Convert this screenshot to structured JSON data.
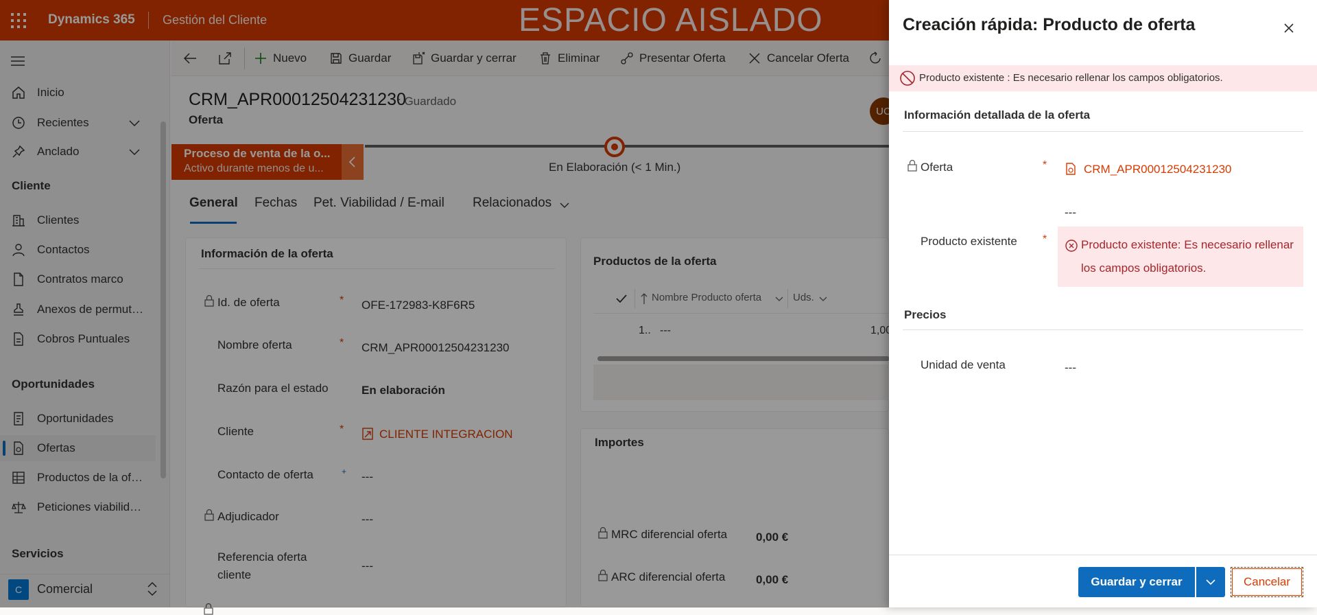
{
  "topbar": {
    "app_name": "Dynamics 365",
    "area_name": "Gestión del Cliente",
    "sandbox_label": "ESPACIO AISLADO"
  },
  "sidebar": {
    "items_top": [
      {
        "label": "Inicio",
        "icon": "home-icon"
      },
      {
        "label": "Recientes",
        "icon": "clock-icon"
      },
      {
        "label": "Anclado",
        "icon": "pin-icon"
      }
    ],
    "sections": [
      {
        "title": "Cliente",
        "items": [
          {
            "label": "Clientes",
            "icon": "building-icon"
          },
          {
            "label": "Contactos",
            "icon": "person-icon"
          },
          {
            "label": "Contratos marco",
            "icon": "document-icon"
          },
          {
            "label": "Anexos de permut…",
            "icon": "stamp-icon"
          },
          {
            "label": "Cobros Puntuales",
            "icon": "document-icon"
          }
        ]
      },
      {
        "title": "Oportunidades",
        "items": [
          {
            "label": "Oportunidades",
            "icon": "document-icon"
          },
          {
            "label": "Ofertas",
            "icon": "quote-icon",
            "selected": true
          },
          {
            "label": "Productos de la of…",
            "icon": "table-icon"
          },
          {
            "label": "Peticiones viabilid…",
            "icon": "scale-icon"
          }
        ]
      },
      {
        "title": "Servicios",
        "items": []
      }
    ],
    "area": {
      "badge": "C",
      "label": "Comercial"
    }
  },
  "commandbar": {
    "nuevo": "Nuevo",
    "guardar": "Guardar",
    "guardar_cerrar": "Guardar y cerrar",
    "eliminar": "Eliminar",
    "presentar": "Presentar Oferta",
    "cancelar": "Cancelar Oferta"
  },
  "record": {
    "title": "CRM_APR00012504231230",
    "status": ": Guardado",
    "entity": "Oferta",
    "avatar": "UC"
  },
  "bpf": {
    "name": "Proceso de venta de la o...",
    "sub": "Activo durante menos de u...",
    "stage": "En Elaboración  (< 1 Min.)"
  },
  "tabs": [
    "General",
    "Fechas",
    "Pet. Viabilidad / E-mail",
    "Relacionados"
  ],
  "info_card": {
    "title": "Información de la oferta",
    "rows": [
      {
        "label": "Id. de oferta",
        "value": "OFE-172983-K8F6R5"
      },
      {
        "label": "Nombre oferta",
        "value": "CRM_APR00012504231230"
      },
      {
        "label": "Razón para el estado",
        "value": "En elaboración"
      },
      {
        "label": "Cliente",
        "value": "CLIENTE INTEGRACION"
      },
      {
        "label": "Contacto de oferta",
        "value": "---"
      },
      {
        "label": "Adjudicador",
        "value": "---"
      },
      {
        "label": "Referencia oferta cliente",
        "value": "---"
      }
    ]
  },
  "products_card": {
    "title": "Productos de la oferta",
    "col_name": "Nombre Producto oferta",
    "col_uds": "Uds.",
    "row_index": "1..",
    "row_name": "---",
    "row_uds": "1,00"
  },
  "importes_card": {
    "title": "Importes",
    "rows": [
      {
        "label": "MRC diferencial oferta",
        "value": "0,00 €"
      },
      {
        "label": "ARC diferencial oferta",
        "value": "0,00 €"
      }
    ]
  },
  "quick_create": {
    "title": "Creación rápida: Producto de oferta",
    "banner": "Producto existente : Es necesario rellenar los campos obligatorios.",
    "section1": "Información detallada de la oferta",
    "oferta_label": "Oferta",
    "oferta_value": "CRM_APR00012504231230",
    "dashes": "---",
    "producto_label": "Producto existente",
    "producto_error": "Producto existente: Es necesario rellenar los campos obligatorios.",
    "section2": "Precios",
    "unidad_label": "Unidad de venta",
    "unidad_value": "---",
    "save_close": "Guardar y cerrar",
    "cancel": "Cancelar"
  },
  "colors": {
    "brand": "#d83b01",
    "primary": "#0f6cbd",
    "error": "#a4262c"
  }
}
